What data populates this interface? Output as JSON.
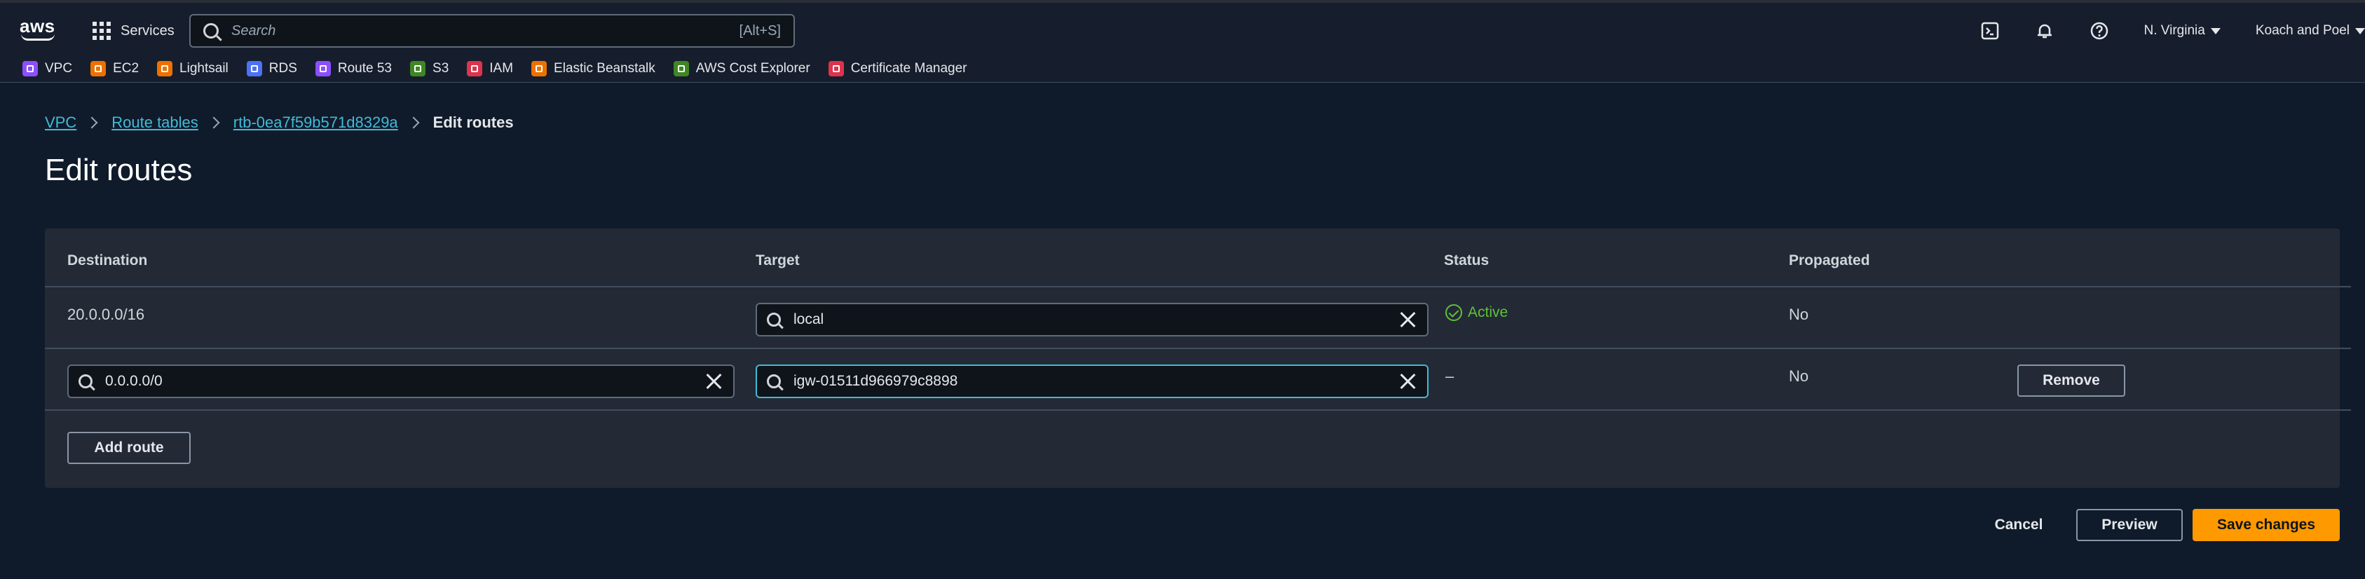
{
  "nav": {
    "logo": "aws",
    "services_label": "Services",
    "search_placeholder": "Search",
    "search_shortcut": "[Alt+S]",
    "region": "N. Virginia",
    "account": "Koach and Poel"
  },
  "favorites": [
    {
      "label": "VPC",
      "color": "#8c4fff"
    },
    {
      "label": "EC2",
      "color": "#ed7100"
    },
    {
      "label": "Lightsail",
      "color": "#ed7100"
    },
    {
      "label": "RDS",
      "color": "#4d72f3"
    },
    {
      "label": "Route 53",
      "color": "#8c4fff"
    },
    {
      "label": "S3",
      "color": "#3f8624"
    },
    {
      "label": "IAM",
      "color": "#dd344c"
    },
    {
      "label": "Elastic Beanstalk",
      "color": "#ed7100"
    },
    {
      "label": "AWS Cost Explorer",
      "color": "#3f8624"
    },
    {
      "label": "Certificate Manager",
      "color": "#dd344c"
    }
  ],
  "breadcrumb": {
    "vpc": "VPC",
    "route_tables": "Route tables",
    "rtb": "rtb-0ea7f59b571d8329a",
    "current": "Edit routes"
  },
  "page_title": "Edit routes",
  "table": {
    "headers": {
      "destination": "Destination",
      "target": "Target",
      "status": "Status",
      "propagated": "Propagated"
    },
    "row1": {
      "destination": "20.0.0.0/16",
      "target": "local",
      "status": "Active",
      "propagated": "No"
    },
    "row2": {
      "destination": "0.0.0.0/0",
      "target": "igw-01511d966979c8898",
      "status": "–",
      "propagated": "No",
      "remove_label": "Remove"
    },
    "add_route_label": "Add route"
  },
  "footer": {
    "cancel": "Cancel",
    "preview": "Preview",
    "save": "Save changes"
  },
  "colors": {
    "accent": "#44b9d6",
    "primary_button": "#ff9900",
    "status_active": "#5fc13a"
  }
}
